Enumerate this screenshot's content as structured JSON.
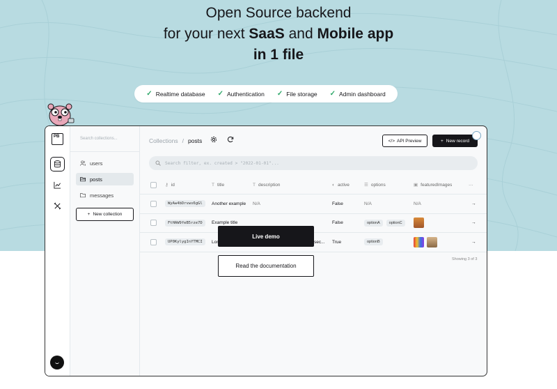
{
  "hero": {
    "line1": "Open Source backend",
    "line2_prefix": "for your next ",
    "line2_b1": "SaaS",
    "line2_mid": " and ",
    "line2_b2": "Mobile app",
    "line3": "in 1 file"
  },
  "features": [
    "Realtime database",
    "Authentication",
    "File storage",
    "Admin dashboard"
  ],
  "logo": "PB",
  "collections_panel": {
    "search_placeholder": "Search collections...",
    "items": [
      "users",
      "posts",
      "messages"
    ],
    "new_collection": "New collection"
  },
  "toolbar": {
    "breadcrumb_root": "Collections",
    "breadcrumb_sep": "/",
    "breadcrumb_current": "posts",
    "api_preview": "API Preview",
    "new_record": "New record"
  },
  "search_filter": {
    "placeholder": "Search filter, ex. created > \"2022-01-01\"..."
  },
  "table": {
    "columns": [
      "id",
      "title",
      "description",
      "active",
      "options",
      "featuredImages"
    ],
    "rows": [
      {
        "id": "WyAw4bDrvws6gGl",
        "title": "Another example",
        "description": "N/A",
        "active": "False",
        "options": [
          "N/A"
        ],
        "images": "N/A"
      },
      {
        "id": "FtHAW9feB5rze7D",
        "title": "Example title",
        "description": "",
        "active": "False",
        "options": [
          "optionA",
          "optionC"
        ],
        "images": ""
      },
      {
        "id": "UP0KylygInYTMCI",
        "title": "Lor",
        "description": "sec...",
        "active": "True",
        "options": [
          "optionB"
        ],
        "images": ""
      }
    ],
    "showing": "Showing 3 of 3"
  },
  "cta": {
    "live_demo": "Live demo",
    "read_docs": "Read the documentation"
  },
  "colors": {
    "hero_bg": "#b8dbe1",
    "accent_dark": "#16161a",
    "check_green": "#2fa86a"
  }
}
